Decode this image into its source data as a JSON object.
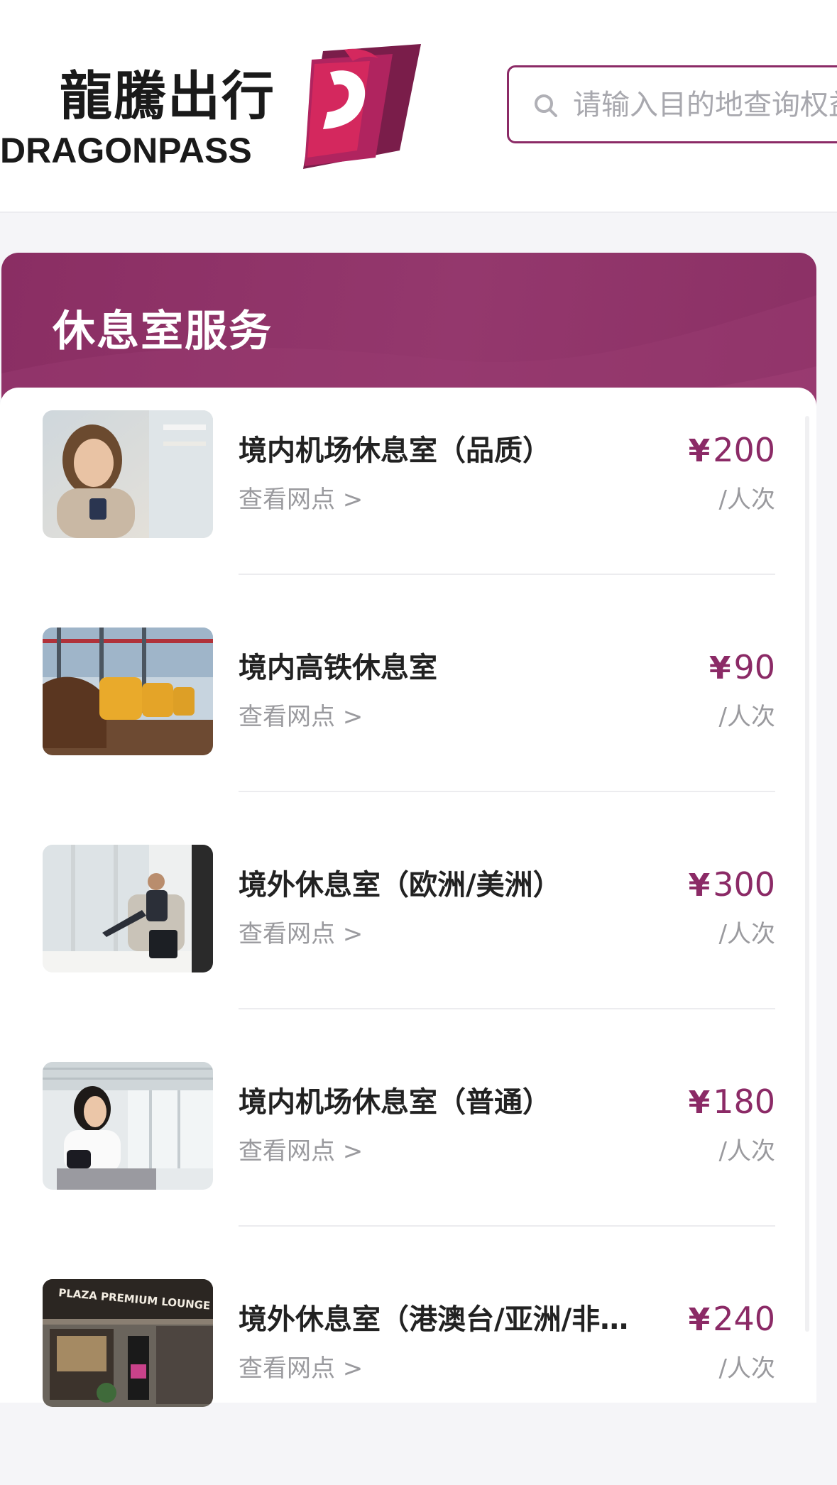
{
  "header": {
    "logo_cn": "龍騰出行",
    "logo_en": "DRAGONPASS",
    "search_placeholder": "请输入目的地查询权益"
  },
  "banner": {
    "title": "休息室服务"
  },
  "items": [
    {
      "title": "境内机场休息室（品质）",
      "link": "查看网点 >",
      "currency": "¥",
      "price": "200",
      "unit": "/人次"
    },
    {
      "title": "境内高铁休息室",
      "link": "查看网点 >",
      "currency": "¥",
      "price": "90",
      "unit": "/人次"
    },
    {
      "title": "境外休息室（欧洲/美洲）",
      "link": "查看网点 >",
      "currency": "¥",
      "price": "300",
      "unit": "/人次"
    },
    {
      "title": "境内机场休息室（普通）",
      "link": "查看网点 >",
      "currency": "¥",
      "price": "180",
      "unit": "/人次"
    },
    {
      "title": "境外休息室（港澳台/亚洲/非…",
      "link": "查看网点 >",
      "currency": "¥",
      "price": "240",
      "unit": "/人次",
      "thumb_text": "PLAZA PREMIUM LOUNGE"
    }
  ],
  "colors": {
    "brand": "#8b2a66",
    "price": "#8b2a66",
    "banner": "#8f3268"
  }
}
